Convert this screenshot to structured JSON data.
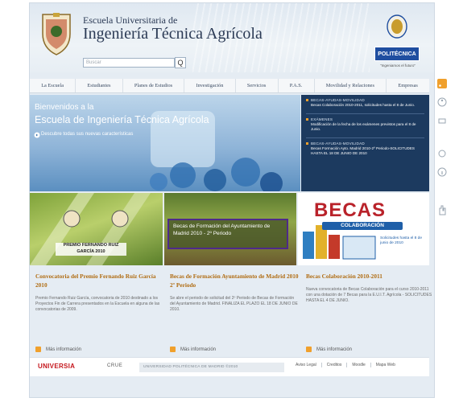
{
  "header": {
    "school_line1": "Escuela Universitaria de",
    "school_line2": "Ingeniería Técnica Agrícola",
    "search_placeholder": "Buscar",
    "search_button": "Q",
    "upm_label": "POLITÉCNICA",
    "upm_slogan": "\"Ingeniamos el futuro\""
  },
  "nav": {
    "items": [
      "La Escuela",
      "Estudiantes",
      "Planes de Estudios",
      "Investigación",
      "Servicios",
      "P.A.S.",
      "Movilidad y Relaciones",
      "Empresas"
    ]
  },
  "hero": {
    "title1": "Bienvenidos a la",
    "title2": "Escuela de Ingeniería Técnica Agrícola",
    "subtitle": "Descubre todas sus nuevas características"
  },
  "news": [
    {
      "category": "BECAS-AYUDAS-MOVILIDAD",
      "text": "Becas Colaboración 2010-2011, solicitudes hasta el 8 de Junio."
    },
    {
      "category": "EXÁMENES",
      "text": "Modificación de la fecha de los exámenes previstos para el 8 de Junio."
    },
    {
      "category": "BECAS-AYUDAS-MOVILIDAD",
      "text": "Becas Formación Ayto. Madrid 2010-2º Periodo-SOLICITUDES HASTA EL 18 DE JUNIO DE 2010"
    }
  ],
  "panels": {
    "p1_caption": "PREMIO FERNANDO RUIZ GARCÍA 2010",
    "p2_caption": "Becas de Formación del Ayuntamiento de Madrid 2010 - 2º Periodo",
    "p3_title": "BECAS",
    "p3_sub": "COLABORACIÓN",
    "p3_date": "Solicitudes hasta el 8 de junio de 2010"
  },
  "columns": [
    {
      "title": "Convocatoria del Premio Fernando Ruiz García 2010",
      "text": "Premio Fernando Ruiz García, convocatoria de 2010 destinado a los Proyectos Fin de Carrera presentados en la Escuela en alguna de las convocatorias de 2009.",
      "more": "Más información"
    },
    {
      "title": "Becas de Formación Ayuntamiento de Madrid 2010 2º Periodo",
      "text": "Se abre el periodo de solicitud del 2º Periodo de Becas de Formación del Ayuntamiento de Madrid. FINALIZA EL PLAZO EL 18 DE JUNIO DE 2010.",
      "more": "Más información"
    },
    {
      "title": "Becas Colaboración 2010-2011",
      "text": "Nueva convocatoria de Becas Colaboración para el curso 2010-2011 con una dotación de 7 Becas para la E.U.I.T. Agrícola - SOLICITUDES HASTA EL 4 DE JUNIO.",
      "more": "Más información"
    }
  ],
  "footer": {
    "logo1": "UNIVERSIA",
    "logo2": "CRUE",
    "copyright": "UNIVERSIDAD POLITÉCNICA DE MADRID ©2010",
    "links": [
      "Aviso Legal",
      "Creditos",
      "Moodle",
      "Mapa Web"
    ]
  },
  "colors": {
    "accent": "#f0a02c",
    "title_orange": "#b06c12",
    "news_bg": "#1c3a5f",
    "upm_blue": "#1f4ea0"
  }
}
